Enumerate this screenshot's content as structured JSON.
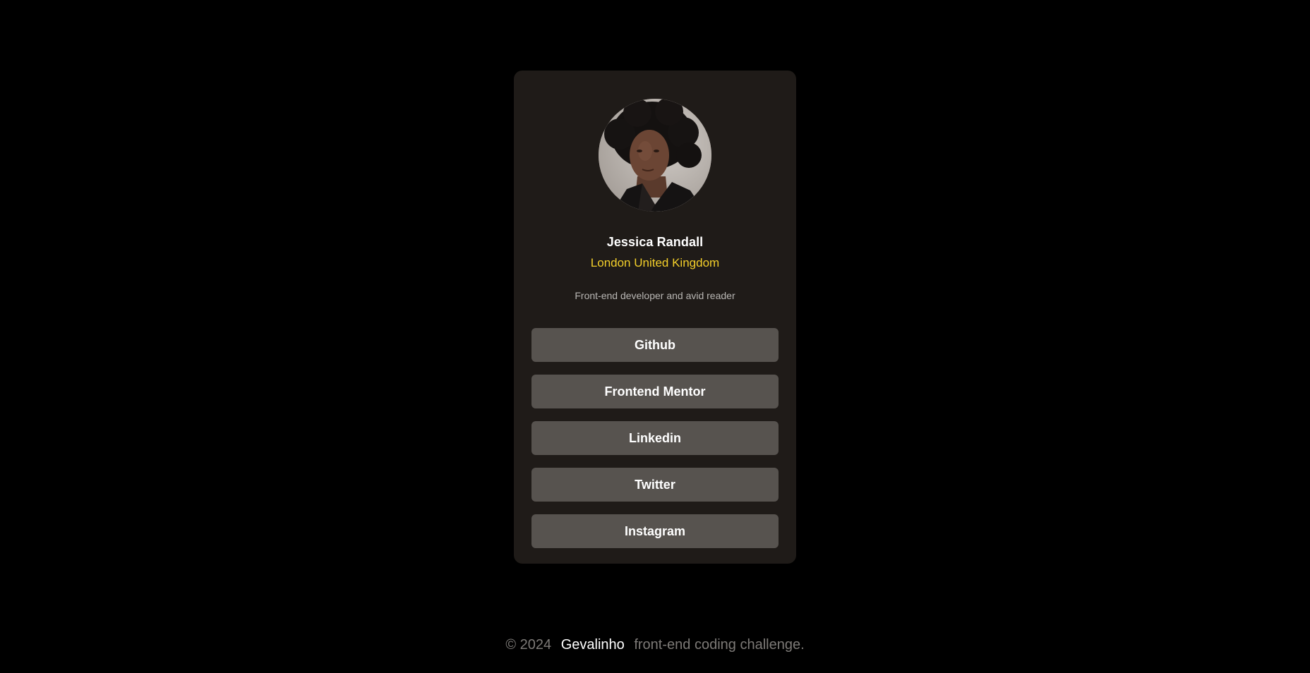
{
  "profile": {
    "name": "Jessica Randall",
    "location": "London United Kingdom",
    "bio": "Front-end developer and avid reader",
    "avatar_icon": "profile-photo"
  },
  "links": [
    {
      "label": "Github"
    },
    {
      "label": "Frontend Mentor"
    },
    {
      "label": "Linkedin"
    },
    {
      "label": "Twitter"
    },
    {
      "label": "Instagram"
    }
  ],
  "footer": {
    "copyright": "© 2024",
    "author": "Gevalinho",
    "suffix": "front-end coding challenge."
  },
  "colors": {
    "background": "#000000",
    "card": "#1f1b18",
    "button": "#57534f",
    "accent": "#f3cf2a"
  }
}
